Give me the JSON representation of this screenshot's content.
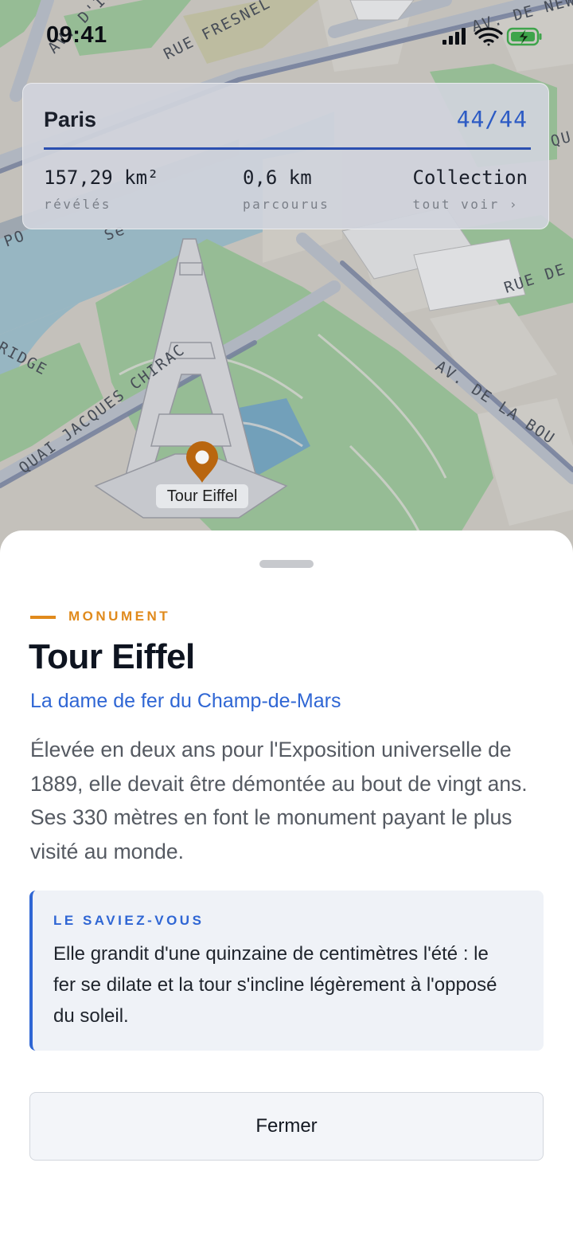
{
  "status_bar": {
    "time": "09:41",
    "icons": [
      "signal-icon",
      "wifi-icon",
      "battery-charging-icon"
    ]
  },
  "map": {
    "street_labels": {
      "rue_fresnel": "RUE FRESNEL",
      "av_new_york": "AV. DE NEW YOR",
      "quai_chirac": "QUAI JACQUES CHIRAC",
      "av_bourdonnais": "AV. DE LA BOU",
      "rue_de": "RUE DE",
      "bridge": "RIDGE",
      "av_top_left": "AV. D'IÉ",
      "po": "PO",
      "qu": "QU",
      "seine": "Se"
    },
    "pin": {
      "icon": "location-pin-icon",
      "label": "Tour Eiffel",
      "color": "#b9660f"
    }
  },
  "stats_card": {
    "city": "Paris",
    "count": "44/44",
    "revealed_value": "157,29 km²",
    "revealed_label": "révélés",
    "walked_value": "0,6 km",
    "walked_label": "parcourus",
    "collection_value": "Collection",
    "collection_label": "tout voir ›",
    "accent_color": "#2d5bc4"
  },
  "sheet": {
    "category": "MONUMENT",
    "title": "Tour Eiffel",
    "subtitle": "La dame de fer du Champ-de-Mars",
    "description": "Élevée en deux ans pour l'Exposition universelle de 1889, elle devait être démontée au bout de vingt ans. Ses 330 mètres en font le monument payant le plus visité au monde.",
    "fact": {
      "title": "LE SAVIEZ-VOUS",
      "text": "Elle grandit d'une quinzaine de centimètres l'été : le fer se dilate et la tour s'incline légèrement à l'opposé du soleil."
    },
    "close_label": "Fermer",
    "category_color": "#e08a1c",
    "link_color": "#2f66d4"
  }
}
